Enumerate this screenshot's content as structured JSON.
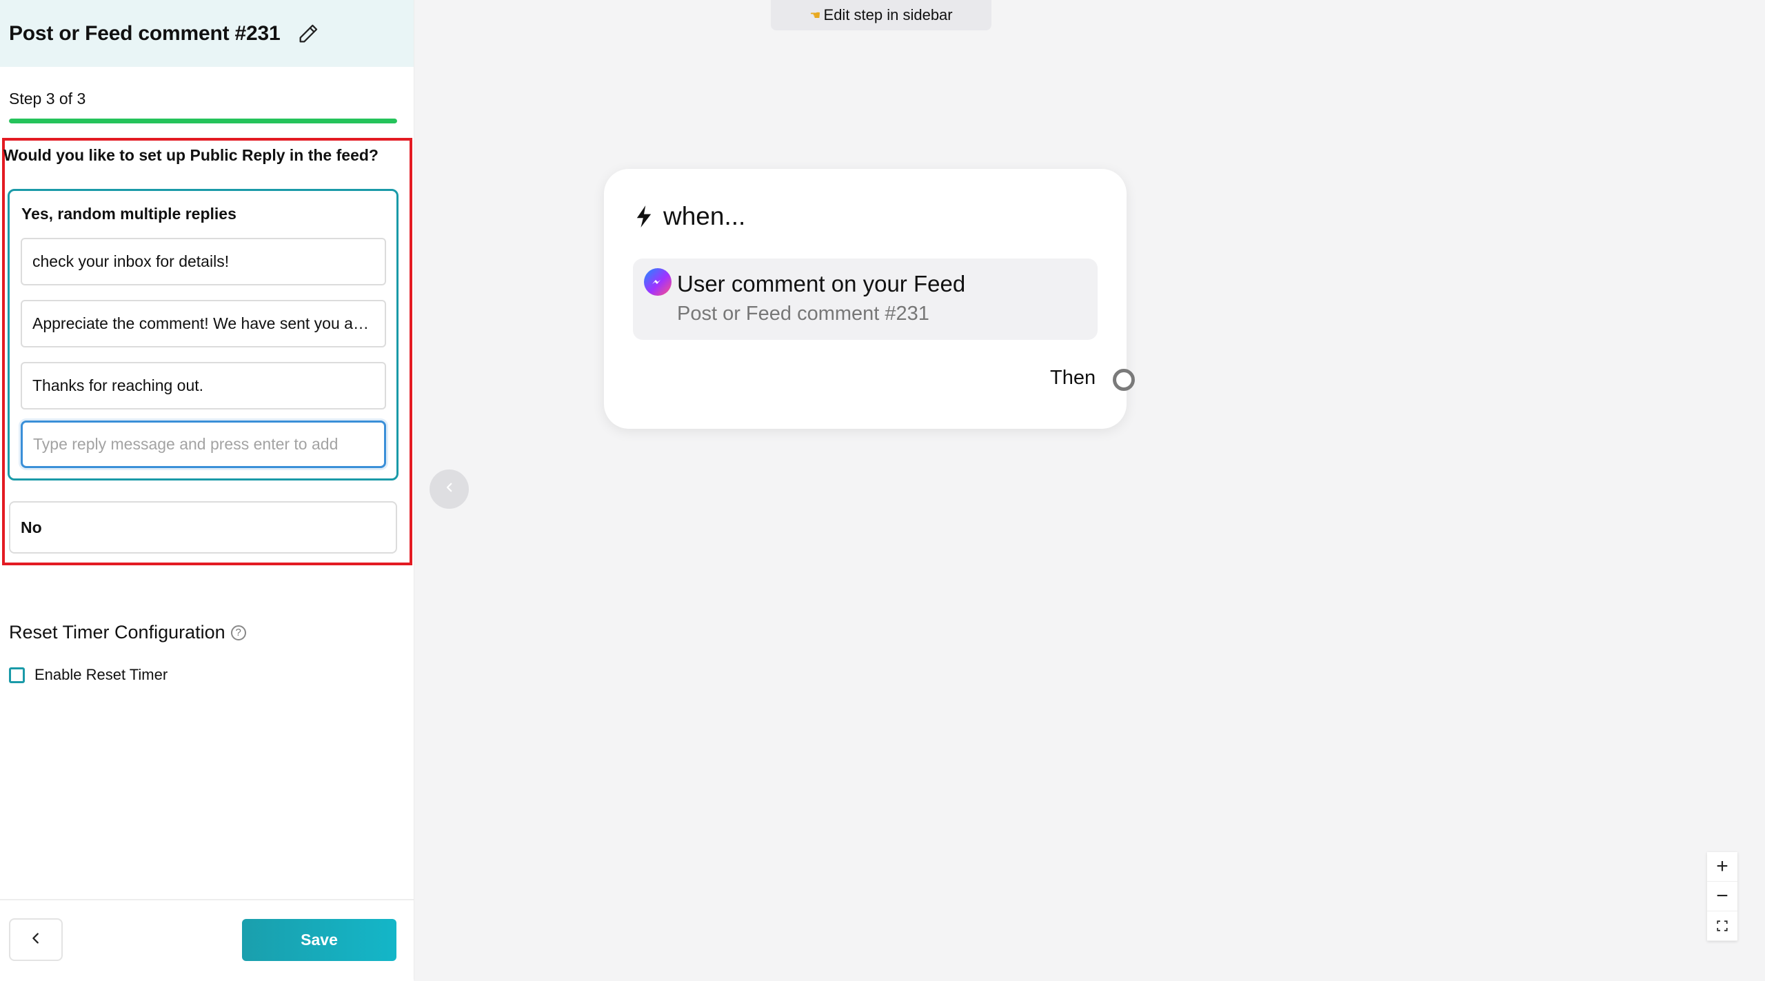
{
  "sidebar": {
    "title": "Post or Feed comment #231",
    "step_label": "Step 3 of 3",
    "progress_fraction": 1.0,
    "question": "Would you like to set up Public Reply in the feed?",
    "option_yes": {
      "label": "Yes, random multiple replies",
      "replies": [
        "check your inbox for details!",
        "Appreciate the comment! We have sent you a message.",
        "Thanks for reaching out."
      ],
      "input_placeholder": "Type reply message and press enter to add"
    },
    "option_no": {
      "label": "No"
    },
    "reset_timer": {
      "title": "Reset Timer Configuration",
      "help_glyph": "?",
      "checkbox_label": "Enable Reset Timer",
      "checked": false
    },
    "footer": {
      "save_label": "Save"
    }
  },
  "canvas": {
    "top_hint": "Edit step in sidebar",
    "node": {
      "when_label": "when...",
      "trigger_title": "User comment on your Feed",
      "trigger_subtitle": "Post or Feed comment #231",
      "then_label": "Then"
    },
    "zoom": {
      "in": "+",
      "out": "−"
    }
  },
  "colors": {
    "accent": "#1a9aa8",
    "progress": "#25c35b",
    "highlight_border": "#e31b23",
    "input_focus": "#3a8fd8"
  }
}
